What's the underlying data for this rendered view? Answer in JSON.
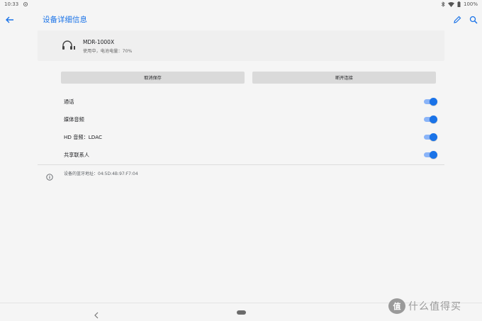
{
  "status_bar": {
    "time": "10:33",
    "battery": "100%"
  },
  "app_bar": {
    "title": "设备详细信息"
  },
  "device": {
    "name": "MDR-1000X",
    "status": "使用中，电池电量：70%"
  },
  "actions": {
    "cancel_label": "取消保存",
    "disconnect_label": "断开连接"
  },
  "settings": [
    {
      "label": "通话",
      "enabled": true
    },
    {
      "label": "媒体音频",
      "enabled": true
    },
    {
      "label": "HD 音频：LDAC",
      "enabled": true
    },
    {
      "label": "共享联系人",
      "enabled": true
    }
  ],
  "info": {
    "bt_address": "设备的蓝牙地址：04:5D:4B:97:F7:04"
  },
  "watermark": {
    "logo": "值",
    "text": "什么值得买"
  },
  "colors": {
    "accent": "#1a73e8",
    "toggle_track": "#8ab4f8"
  },
  "icons": [
    "settings-sync-icon",
    "bluetooth-icon",
    "wifi-icon",
    "battery-icon",
    "back-arrow-icon",
    "edit-icon",
    "search-icon",
    "headphones-icon",
    "info-icon",
    "nav-back-icon"
  ]
}
